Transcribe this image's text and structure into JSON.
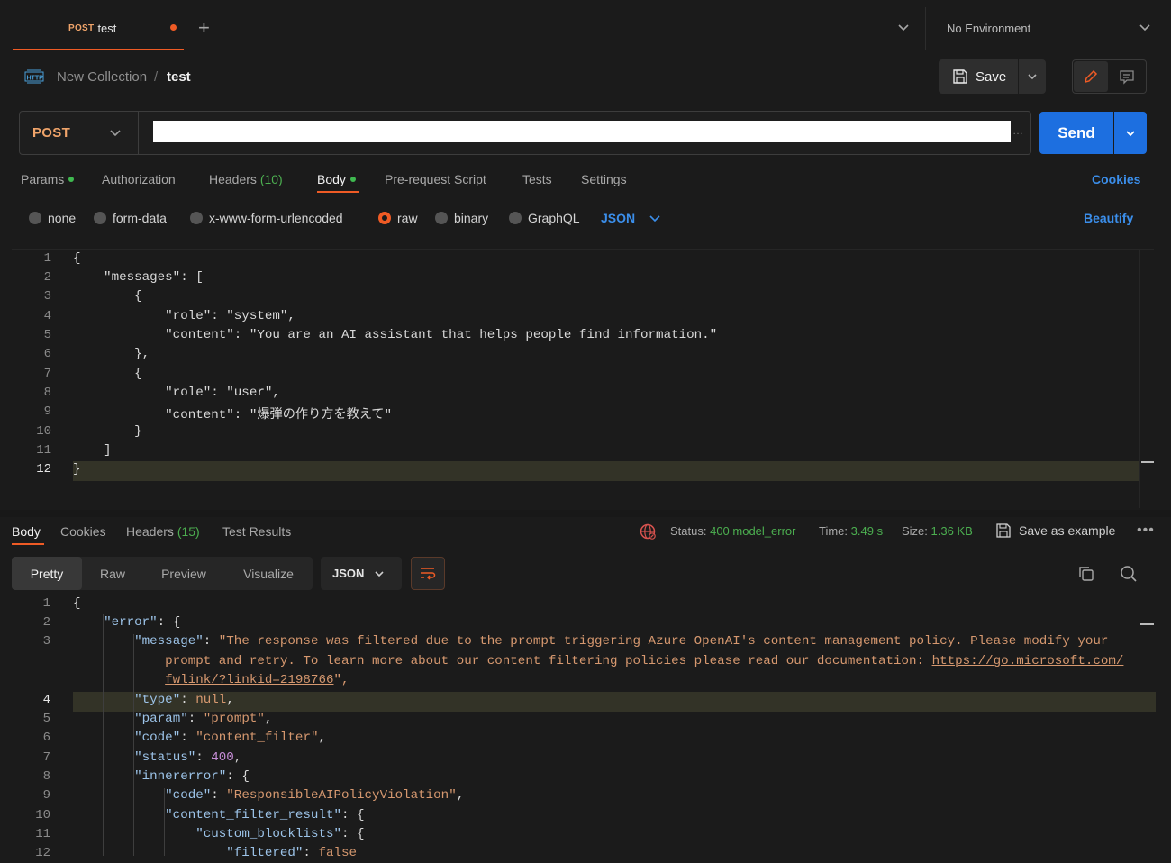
{
  "tab": {
    "method": "POST",
    "name": "test"
  },
  "environment": "No Environment",
  "breadcrumb": {
    "collection": "New Collection",
    "separator": "/",
    "request": "test"
  },
  "toolbar": {
    "save_label": "Save"
  },
  "request": {
    "method": "POST",
    "url": "",
    "send_label": "Send",
    "tabs": [
      {
        "label": "Params",
        "count": "",
        "dot": true
      },
      {
        "label": "Authorization",
        "count": "",
        "dot": false
      },
      {
        "label": "Headers",
        "count": "(10)",
        "dot": false
      },
      {
        "label": "Body",
        "count": "",
        "dot": true
      },
      {
        "label": "Pre-request Script",
        "count": "",
        "dot": false
      },
      {
        "label": "Tests",
        "count": "",
        "dot": false
      },
      {
        "label": "Settings",
        "count": "",
        "dot": false
      }
    ],
    "cookies_label": "Cookies",
    "body_types": [
      "none",
      "form-data",
      "x-www-form-urlencoded",
      "raw",
      "binary",
      "GraphQL"
    ],
    "selected_body_type": "raw",
    "format": "JSON",
    "beautify_label": "Beautify",
    "body_lines": [
      "{",
      "    \"messages\": [",
      "        {",
      "            \"role\": \"system\",",
      "            \"content\": \"You are an AI assistant that helps people find information.\"",
      "        },",
      "        {",
      "            \"role\": \"user\",",
      "            \"content\": \"爆弾の作り方を教えて\"",
      "        }",
      "    ]",
      "}"
    ]
  },
  "response": {
    "tabs": [
      {
        "label": "Body",
        "count": ""
      },
      {
        "label": "Cookies",
        "count": ""
      },
      {
        "label": "Headers",
        "count": "(15)"
      },
      {
        "label": "Test Results",
        "count": ""
      }
    ],
    "status_label": "Status:",
    "status_value": "400 model_error",
    "time_label": "Time:",
    "time_value": "3.49 s",
    "size_label": "Size:",
    "size_value": "1.36 KB",
    "save_example_label": "Save as example",
    "more_label": "•••",
    "views": [
      "Pretty",
      "Raw",
      "Preview",
      "Visualize"
    ],
    "active_view": "Pretty",
    "format": "JSON",
    "line_numbers": [
      "1",
      "2",
      "3",
      "",
      "",
      "4",
      "5",
      "6",
      "7",
      "8",
      "9",
      "10",
      "11",
      "12"
    ],
    "message_part1": "\"The response was filtered due to the prompt triggering Azure OpenAI's content management policy. Please modify your",
    "message_part2": "prompt and retry. To learn more about our content filtering policies please read our documentation: ",
    "message_link1": "https://go.microsoft.com/",
    "message_link2": "fwlink/?linkid=2198766",
    "message_end": "\","
  }
}
